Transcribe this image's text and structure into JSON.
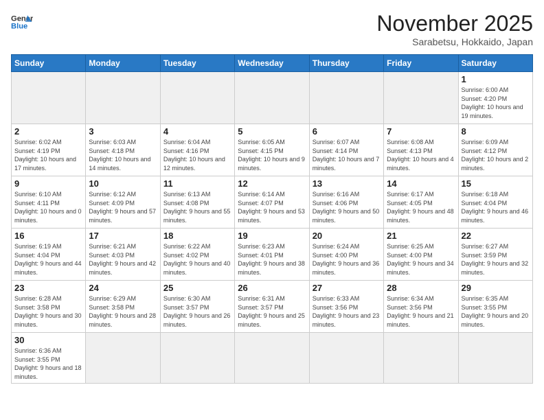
{
  "header": {
    "logo_general": "General",
    "logo_blue": "Blue",
    "month_title": "November 2025",
    "location": "Sarabetsu, Hokkaido, Japan"
  },
  "weekdays": [
    "Sunday",
    "Monday",
    "Tuesday",
    "Wednesday",
    "Thursday",
    "Friday",
    "Saturday"
  ],
  "days": {
    "d1": {
      "num": "1",
      "sunrise": "6:00 AM",
      "sunset": "4:20 PM",
      "daylight": "10 hours and 19 minutes."
    },
    "d2": {
      "num": "2",
      "sunrise": "6:02 AM",
      "sunset": "4:19 PM",
      "daylight": "10 hours and 17 minutes."
    },
    "d3": {
      "num": "3",
      "sunrise": "6:03 AM",
      "sunset": "4:18 PM",
      "daylight": "10 hours and 14 minutes."
    },
    "d4": {
      "num": "4",
      "sunrise": "6:04 AM",
      "sunset": "4:16 PM",
      "daylight": "10 hours and 12 minutes."
    },
    "d5": {
      "num": "5",
      "sunrise": "6:05 AM",
      "sunset": "4:15 PM",
      "daylight": "10 hours and 9 minutes."
    },
    "d6": {
      "num": "6",
      "sunrise": "6:07 AM",
      "sunset": "4:14 PM",
      "daylight": "10 hours and 7 minutes."
    },
    "d7": {
      "num": "7",
      "sunrise": "6:08 AM",
      "sunset": "4:13 PM",
      "daylight": "10 hours and 4 minutes."
    },
    "d8": {
      "num": "8",
      "sunrise": "6:09 AM",
      "sunset": "4:12 PM",
      "daylight": "10 hours and 2 minutes."
    },
    "d9": {
      "num": "9",
      "sunrise": "6:10 AM",
      "sunset": "4:11 PM",
      "daylight": "10 hours and 0 minutes."
    },
    "d10": {
      "num": "10",
      "sunrise": "6:12 AM",
      "sunset": "4:09 PM",
      "daylight": "9 hours and 57 minutes."
    },
    "d11": {
      "num": "11",
      "sunrise": "6:13 AM",
      "sunset": "4:08 PM",
      "daylight": "9 hours and 55 minutes."
    },
    "d12": {
      "num": "12",
      "sunrise": "6:14 AM",
      "sunset": "4:07 PM",
      "daylight": "9 hours and 53 minutes."
    },
    "d13": {
      "num": "13",
      "sunrise": "6:16 AM",
      "sunset": "4:06 PM",
      "daylight": "9 hours and 50 minutes."
    },
    "d14": {
      "num": "14",
      "sunrise": "6:17 AM",
      "sunset": "4:05 PM",
      "daylight": "9 hours and 48 minutes."
    },
    "d15": {
      "num": "15",
      "sunrise": "6:18 AM",
      "sunset": "4:04 PM",
      "daylight": "9 hours and 46 minutes."
    },
    "d16": {
      "num": "16",
      "sunrise": "6:19 AM",
      "sunset": "4:04 PM",
      "daylight": "9 hours and 44 minutes."
    },
    "d17": {
      "num": "17",
      "sunrise": "6:21 AM",
      "sunset": "4:03 PM",
      "daylight": "9 hours and 42 minutes."
    },
    "d18": {
      "num": "18",
      "sunrise": "6:22 AM",
      "sunset": "4:02 PM",
      "daylight": "9 hours and 40 minutes."
    },
    "d19": {
      "num": "19",
      "sunrise": "6:23 AM",
      "sunset": "4:01 PM",
      "daylight": "9 hours and 38 minutes."
    },
    "d20": {
      "num": "20",
      "sunrise": "6:24 AM",
      "sunset": "4:00 PM",
      "daylight": "9 hours and 36 minutes."
    },
    "d21": {
      "num": "21",
      "sunrise": "6:25 AM",
      "sunset": "4:00 PM",
      "daylight": "9 hours and 34 minutes."
    },
    "d22": {
      "num": "22",
      "sunrise": "6:27 AM",
      "sunset": "3:59 PM",
      "daylight": "9 hours and 32 minutes."
    },
    "d23": {
      "num": "23",
      "sunrise": "6:28 AM",
      "sunset": "3:58 PM",
      "daylight": "9 hours and 30 minutes."
    },
    "d24": {
      "num": "24",
      "sunrise": "6:29 AM",
      "sunset": "3:58 PM",
      "daylight": "9 hours and 28 minutes."
    },
    "d25": {
      "num": "25",
      "sunrise": "6:30 AM",
      "sunset": "3:57 PM",
      "daylight": "9 hours and 26 minutes."
    },
    "d26": {
      "num": "26",
      "sunrise": "6:31 AM",
      "sunset": "3:57 PM",
      "daylight": "9 hours and 25 minutes."
    },
    "d27": {
      "num": "27",
      "sunrise": "6:33 AM",
      "sunset": "3:56 PM",
      "daylight": "9 hours and 23 minutes."
    },
    "d28": {
      "num": "28",
      "sunrise": "6:34 AM",
      "sunset": "3:56 PM",
      "daylight": "9 hours and 21 minutes."
    },
    "d29": {
      "num": "29",
      "sunrise": "6:35 AM",
      "sunset": "3:55 PM",
      "daylight": "9 hours and 20 minutes."
    },
    "d30": {
      "num": "30",
      "sunrise": "6:36 AM",
      "sunset": "3:55 PM",
      "daylight": "9 hours and 18 minutes."
    }
  }
}
